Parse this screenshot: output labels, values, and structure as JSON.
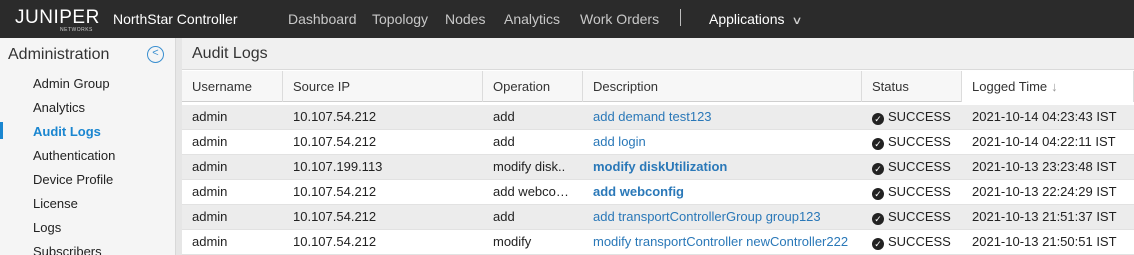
{
  "header": {
    "logo_text": "JUNIPER",
    "logo_sub": "NETWORKS",
    "product": "NorthStar Controller",
    "nav": [
      "Dashboard",
      "Topology",
      "Nodes",
      "Analytics",
      "Work Orders"
    ],
    "applications_label": "Applications",
    "chevron_icon": "chevron-down-icon"
  },
  "sidebar": {
    "title": "Administration",
    "collapse_icon": "chevron-left-circle-icon",
    "items": [
      {
        "label": "Admin Group",
        "active": false
      },
      {
        "label": "Analytics",
        "active": false
      },
      {
        "label": "Audit Logs",
        "active": true
      },
      {
        "label": "Authentication",
        "active": false
      },
      {
        "label": "Device Profile",
        "active": false
      },
      {
        "label": "License",
        "active": false
      },
      {
        "label": "Logs",
        "active": false
      },
      {
        "label": "Subscribers",
        "active": false
      }
    ]
  },
  "main": {
    "title": "Audit Logs",
    "columns": [
      "Username",
      "Source IP",
      "Operation",
      "Description",
      "Status",
      "Logged Time"
    ],
    "sort_indicator": "↓",
    "rows": [
      {
        "username": "admin",
        "source_ip": "10.107.54.212",
        "operation": "add",
        "description": "add demand test123",
        "status": "SUCCESS",
        "time": "2021-10-14 04:23:43 IST"
      },
      {
        "username": "admin",
        "source_ip": "10.107.54.212",
        "operation": "add",
        "description": "add login",
        "status": "SUCCESS",
        "time": "2021-10-14 04:22:11 IST"
      },
      {
        "username": "admin",
        "source_ip": "10.107.199.113",
        "operation": "modify disk..",
        "description": "modify diskUtilization",
        "status": "SUCCESS",
        "time": "2021-10-13 23:23:48 IST"
      },
      {
        "username": "admin",
        "source_ip": "10.107.54.212",
        "operation": "add webco…",
        "description": "add webconfig",
        "status": "SUCCESS",
        "time": "2021-10-13 22:24:29 IST"
      },
      {
        "username": "admin",
        "source_ip": "10.107.54.212",
        "operation": "add",
        "description": "add transportControllerGroup group123",
        "status": "SUCCESS",
        "time": "2021-10-13 21:51:37 IST"
      },
      {
        "username": "admin",
        "source_ip": "10.107.54.212",
        "operation": "modify",
        "description": "modify transportController newController222",
        "status": "SUCCESS",
        "time": "2021-10-13 21:50:51 IST"
      }
    ],
    "status_icon": "check-circle-icon",
    "colors": {
      "accent": "#1a86d0",
      "link": "#2a78b8",
      "topbar": "#2b2b2b"
    }
  }
}
